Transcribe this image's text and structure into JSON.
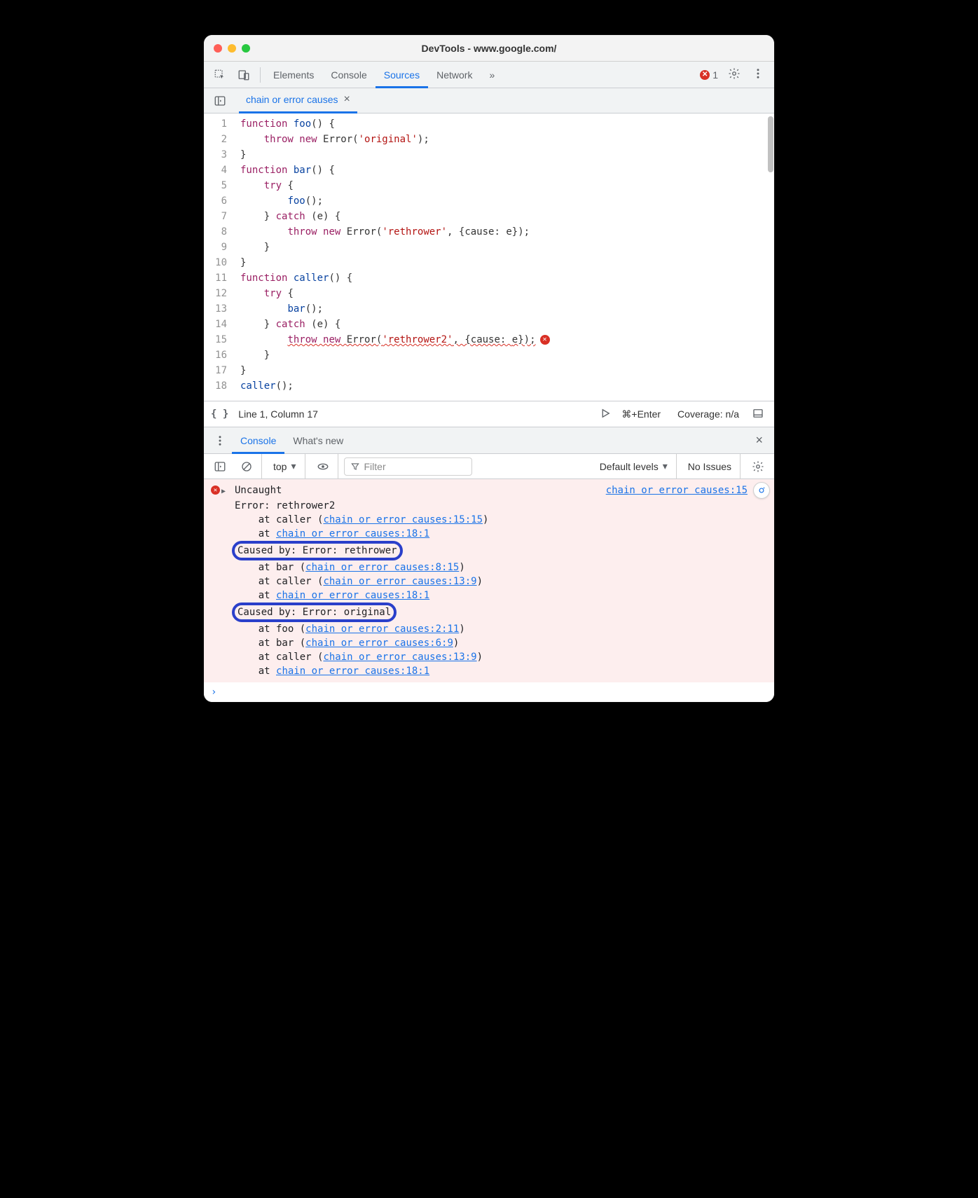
{
  "window": {
    "title": "DevTools - www.google.com/"
  },
  "tabs": {
    "main": [
      "Elements",
      "Console",
      "Sources",
      "Network"
    ],
    "active": "Sources",
    "overflow": "»",
    "error_count": "1"
  },
  "file_tab": {
    "name": "chain or error causes"
  },
  "code": {
    "lines": [
      {
        "n": "1",
        "tokens": [
          [
            "kw",
            "function "
          ],
          [
            "fn",
            "foo"
          ],
          [
            "pn",
            "() {"
          ]
        ]
      },
      {
        "n": "2",
        "tokens": [
          [
            "pn",
            "    "
          ],
          [
            "kw",
            "throw new "
          ],
          [
            "nm",
            "Error("
          ],
          [
            "str",
            "'original'"
          ],
          [
            "pn",
            ");"
          ]
        ]
      },
      {
        "n": "3",
        "tokens": [
          [
            "pn",
            "}"
          ]
        ]
      },
      {
        "n": "4",
        "tokens": [
          [
            "kw",
            "function "
          ],
          [
            "fn",
            "bar"
          ],
          [
            "pn",
            "() {"
          ]
        ]
      },
      {
        "n": "5",
        "tokens": [
          [
            "pn",
            "    "
          ],
          [
            "kw",
            "try"
          ],
          [
            "pn",
            " {"
          ]
        ]
      },
      {
        "n": "6",
        "tokens": [
          [
            "pn",
            "        "
          ],
          [
            "fn",
            "foo"
          ],
          [
            "pn",
            "();"
          ]
        ]
      },
      {
        "n": "7",
        "tokens": [
          [
            "pn",
            "    } "
          ],
          [
            "kw",
            "catch"
          ],
          [
            "pn",
            " ("
          ],
          [
            "nm",
            "e"
          ],
          [
            "pn",
            ") {"
          ]
        ]
      },
      {
        "n": "8",
        "tokens": [
          [
            "pn",
            "        "
          ],
          [
            "kw",
            "throw new "
          ],
          [
            "nm",
            "Error("
          ],
          [
            "str",
            "'rethrower'"
          ],
          [
            "pn",
            ", {"
          ],
          [
            "nm",
            "cause"
          ],
          [
            "pn",
            ": "
          ],
          [
            "nm",
            "e"
          ],
          [
            "pn",
            "});"
          ]
        ]
      },
      {
        "n": "9",
        "tokens": [
          [
            "pn",
            "    }"
          ]
        ]
      },
      {
        "n": "10",
        "tokens": [
          [
            "pn",
            "}"
          ]
        ]
      },
      {
        "n": "11",
        "tokens": [
          [
            "kw",
            "function "
          ],
          [
            "fn",
            "caller"
          ],
          [
            "pn",
            "() {"
          ]
        ]
      },
      {
        "n": "12",
        "tokens": [
          [
            "pn",
            "    "
          ],
          [
            "kw",
            "try"
          ],
          [
            "pn",
            " {"
          ]
        ]
      },
      {
        "n": "13",
        "tokens": [
          [
            "pn",
            "        "
          ],
          [
            "fn",
            "bar"
          ],
          [
            "pn",
            "();"
          ]
        ]
      },
      {
        "n": "14",
        "tokens": [
          [
            "pn",
            "    } "
          ],
          [
            "kw",
            "catch"
          ],
          [
            "pn",
            " ("
          ],
          [
            "nm",
            "e"
          ],
          [
            "pn",
            ") {"
          ]
        ]
      },
      {
        "n": "15",
        "tokens": [
          [
            "pn",
            "        "
          ],
          [
            "kw",
            "throw new "
          ],
          [
            "nm",
            "Error("
          ],
          [
            "str",
            "'rethrower2'"
          ],
          [
            "pn",
            ", {"
          ],
          [
            "nm",
            "cause"
          ],
          [
            "pn",
            ": "
          ],
          [
            "nm",
            "e"
          ],
          [
            "pn",
            "});"
          ]
        ],
        "wavy": true,
        "err": true
      },
      {
        "n": "16",
        "tokens": [
          [
            "pn",
            "    }"
          ]
        ]
      },
      {
        "n": "17",
        "tokens": [
          [
            "pn",
            "}"
          ]
        ]
      },
      {
        "n": "18",
        "tokens": [
          [
            "fn",
            "caller"
          ],
          [
            "pn",
            "();"
          ]
        ]
      }
    ]
  },
  "statusbar": {
    "pretty_print": "{ }",
    "position": "Line 1, Column 17",
    "run_hint": "⌘+Enter",
    "coverage": "Coverage: n/a"
  },
  "drawer": {
    "tabs": [
      "Console",
      "What's new"
    ],
    "active": "Console"
  },
  "console_toolbar": {
    "context": "top",
    "filter_placeholder": "Filter",
    "levels": "Default levels",
    "issues": "No Issues"
  },
  "console": {
    "source_link": "chain or error causes:15",
    "lines": [
      {
        "indent": 0,
        "type": "err-head",
        "text": "Uncaught"
      },
      {
        "indent": 0,
        "text": "Error: rethrower2"
      },
      {
        "indent": 0,
        "text": "    at caller (",
        "link": "chain or error causes:15:15",
        "suffix": ")"
      },
      {
        "indent": 0,
        "text": "    at ",
        "link": "chain or error causes:18:1"
      },
      {
        "indent": 0,
        "highlight": true,
        "text": "Caused by: Error: rethrower"
      },
      {
        "indent": 0,
        "text": "    at bar (",
        "link": "chain or error causes:8:15",
        "suffix": ")"
      },
      {
        "indent": 0,
        "text": "    at caller (",
        "link": "chain or error causes:13:9",
        "suffix": ")"
      },
      {
        "indent": 0,
        "text": "    at ",
        "link": "chain or error causes:18:1"
      },
      {
        "indent": 0,
        "highlight": true,
        "text": "Caused by: Error: original"
      },
      {
        "indent": 0,
        "text": "    at foo (",
        "link": "chain or error causes:2:11",
        "suffix": ")"
      },
      {
        "indent": 0,
        "text": "    at bar (",
        "link": "chain or error causes:6:9",
        "suffix": ")"
      },
      {
        "indent": 0,
        "text": "    at caller (",
        "link": "chain or error causes:13:9",
        "suffix": ")"
      },
      {
        "indent": 0,
        "text": "    at ",
        "link": "chain or error causes:18:1"
      }
    ],
    "prompt": "›"
  }
}
